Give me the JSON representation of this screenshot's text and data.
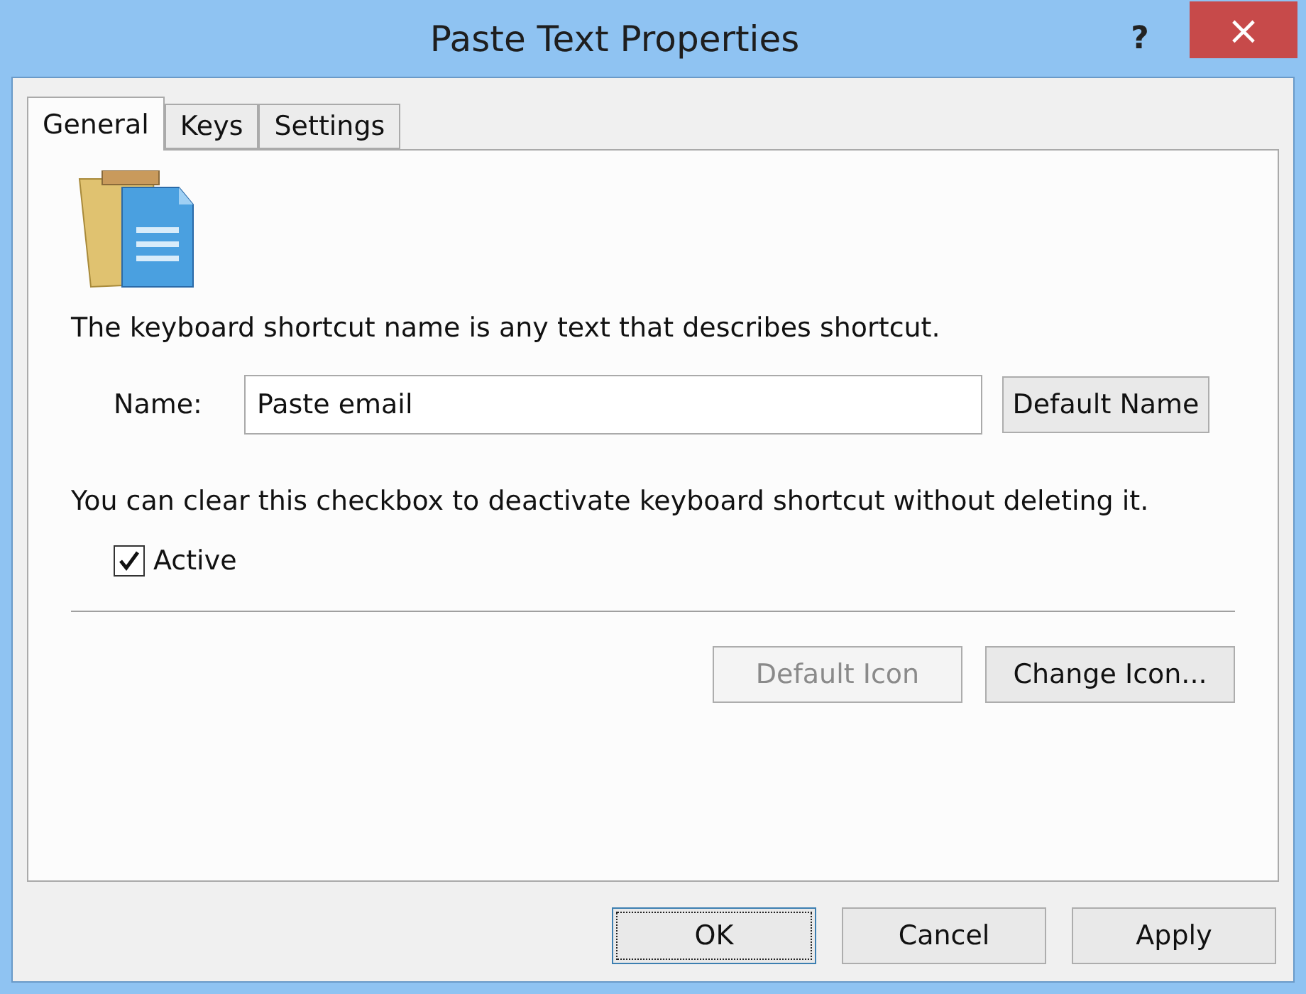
{
  "window": {
    "title": "Paste Text Properties",
    "help": "?",
    "close": "×"
  },
  "tabs": [
    {
      "label": "General",
      "selected": true
    },
    {
      "label": "Keys",
      "selected": false
    },
    {
      "label": "Settings",
      "selected": false
    }
  ],
  "general": {
    "description": "The keyboard shortcut name is any text that describes shortcut.",
    "name_label": "Name:",
    "name_value": "Paste email",
    "default_name_button": "Default Name",
    "active_hint": "You can clear this checkbox to deactivate keyboard shortcut without deleting it.",
    "active": {
      "label": "Active",
      "checked": true
    },
    "icon_buttons": [
      {
        "label": "Default Icon",
        "disabled": true
      },
      {
        "label": "Change Icon...",
        "disabled": false
      }
    ]
  },
  "buttons": [
    {
      "label": "OK",
      "default": true
    },
    {
      "label": "Cancel",
      "default": false
    },
    {
      "label": "Apply",
      "default": false
    }
  ]
}
